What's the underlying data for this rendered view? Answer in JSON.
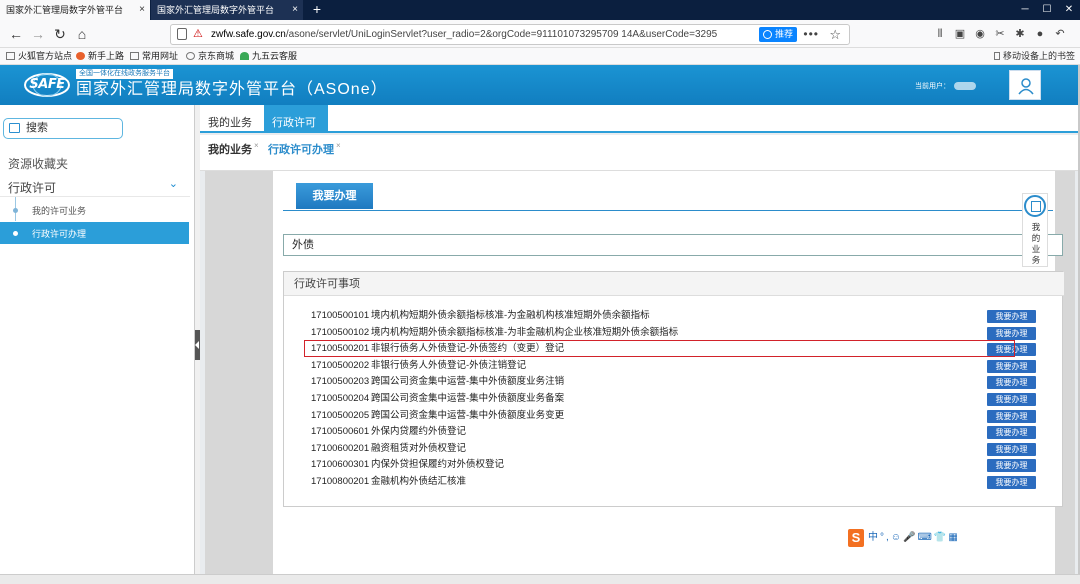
{
  "browser": {
    "tabs": [
      {
        "label": "国家外汇管理局数字外管平台",
        "close": "×"
      },
      {
        "label": "国家外汇管理局数字外管平台",
        "close": "×"
      }
    ],
    "new_tab": "+",
    "url_host": "zwfw.safe.gov.cn",
    "url_rest": "/asone/servlet/UniLoginServlet?user_radio=2&orgCode=911101073295709 14A&userCode=3295",
    "recommend": "推荐",
    "bookmarks": [
      "火狐官方站点",
      "新手上路",
      "常用网址",
      "京东商城",
      "九五云客服"
    ],
    "mobile_bookmarks": "移动设备上的书签"
  },
  "app": {
    "logo": "SAFE",
    "subtitle": "全国一体化在线政务服务平台",
    "title": "国家外汇管理局数字外管平台（ASOne）",
    "current_user_label": "当前用户："
  },
  "sidebar": {
    "search": "搜索",
    "favorites": "资源收藏夹",
    "group": "行政许可",
    "items": [
      {
        "label": "我的许可业务",
        "active": false
      },
      {
        "label": "行政许可办理",
        "active": true
      }
    ]
  },
  "tabs_top": [
    {
      "label": "我的业务",
      "active": false
    },
    {
      "label": "行政许可",
      "active": true
    }
  ],
  "tabs_sub": [
    {
      "label": "我的业务",
      "close": "×",
      "active": false
    },
    {
      "label": "行政许可办理",
      "close": "×",
      "active": true
    }
  ],
  "main": {
    "section_button": "我要办理",
    "search_value": "外债",
    "list_title": "行政许可事项",
    "action_label": "我要办理",
    "items": [
      {
        "code": "17100500101",
        "name": "境内机构短期外债余额指标核准-为金融机构核准短期外债余额指标"
      },
      {
        "code": "17100500102",
        "name": "境内机构短期外债余额指标核准-为非金融机构企业核准短期外债余额指标"
      },
      {
        "code": "17100500201",
        "name": "非银行债务人外债登记-外债签约（变更）登记"
      },
      {
        "code": "17100500202",
        "name": "非银行债务人外债登记-外债注销登记"
      },
      {
        "code": "17100500203",
        "name": "跨国公司资金集中运营-集中外债额度业务注销"
      },
      {
        "code": "17100500204",
        "name": "跨国公司资金集中运营-集中外债额度业务备案"
      },
      {
        "code": "17100500205",
        "name": "跨国公司资金集中运营-集中外债额度业务变更"
      },
      {
        "code": "17100500601",
        "name": "外保内贷履约外债登记"
      },
      {
        "code": "17100600201",
        "name": "融资租赁对外债权登记"
      },
      {
        "code": "17100600301",
        "name": "内保外贷担保履约对外债权登记"
      },
      {
        "code": "17100800201",
        "name": "金融机构外债结汇核准"
      }
    ],
    "highlighted_index": 2
  },
  "float_tool": {
    "label": "我的业务"
  },
  "ime": {
    "logo": "S",
    "text": "中°,☺🎤⌨👕▦"
  },
  "colors": {
    "brand": "#1b94d3",
    "accent": "#2b9ed9",
    "highlight": "#d2222a",
    "button": "#2b6cbf"
  }
}
